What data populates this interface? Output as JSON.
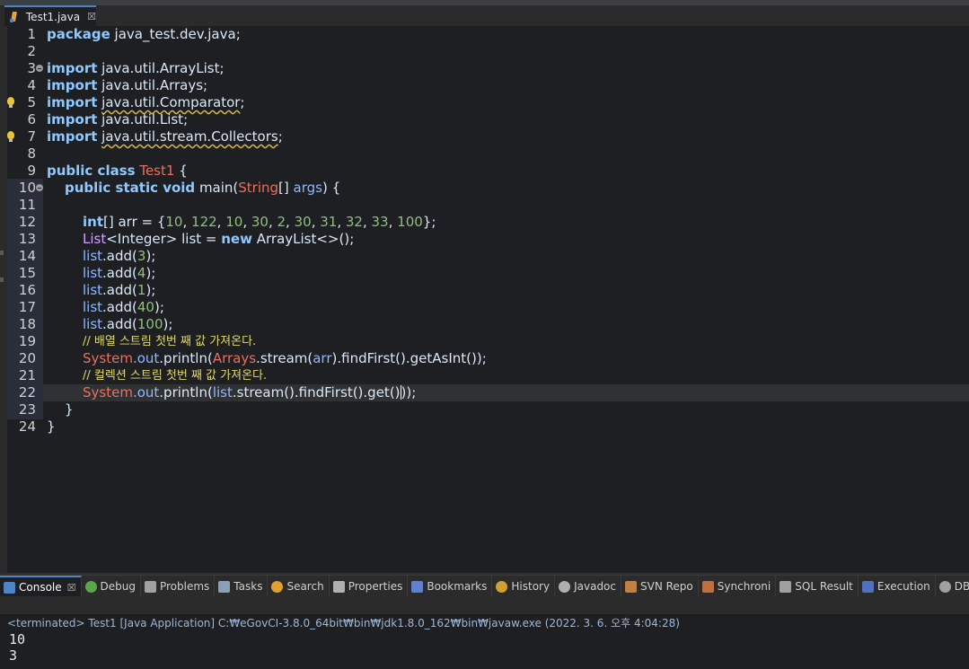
{
  "editor_tab": {
    "title": "Test1.java",
    "close": "☒"
  },
  "code_lines": [
    {
      "n": "1"
    },
    {
      "n": "2"
    },
    {
      "n": "3"
    },
    {
      "n": "4"
    },
    {
      "n": "5"
    },
    {
      "n": "6"
    },
    {
      "n": "7"
    },
    {
      "n": "8"
    },
    {
      "n": "9"
    },
    {
      "n": "10"
    },
    {
      "n": "11"
    },
    {
      "n": "12"
    },
    {
      "n": "13"
    },
    {
      "n": "14"
    },
    {
      "n": "15"
    },
    {
      "n": "16"
    },
    {
      "n": "17"
    },
    {
      "n": "18"
    },
    {
      "n": "19"
    },
    {
      "n": "20"
    },
    {
      "n": "21"
    },
    {
      "n": "22"
    },
    {
      "n": "23"
    },
    {
      "n": "24"
    }
  ],
  "code": {
    "package_kw": "package",
    "package_name": " java_test.dev.java;",
    "import_kw": "import",
    "imp1": " java.util.ArrayList;",
    "imp2": " java.util.Arrays;",
    "imp3_a": " ",
    "imp3_b": "java.util.Comparator",
    "imp3_c": ";",
    "imp4": " java.util.List;",
    "imp5_a": " ",
    "imp5_b": "java.util.stream.Collectors",
    "imp5_c": ";",
    "public_class": "public class",
    "class_name": "Test1",
    "brace_open": " {",
    "main_mods": "public static void",
    "main_name": " main(",
    "string_type": "String",
    "main_args_a": "[] ",
    "main_args": "args",
    "main_args_b": ") {",
    "int_kw": "int",
    "arr_decl": "[] arr = {",
    "arr_vals": [
      "10",
      "122",
      "10",
      "30",
      "2",
      "30",
      "31",
      "32",
      "33",
      "100"
    ],
    "arr_end": "};",
    "list_type": "List",
    "integer_generic": "<Integer>",
    "list_decl": " list = ",
    "new_kw": "new",
    "list_init": " ArrayList<>();",
    "list_var": "list",
    "add_call": ".add(",
    "add_vals": [
      "3",
      "4",
      "1",
      "40",
      "100"
    ],
    "add_end": ");",
    "comment1": "// 배열 스트림 첫번 째 값 가져온다.",
    "system": "System",
    "out_field": ".out",
    "println": ".println(",
    "arrays_cls": "Arrays",
    "stream_call": ".stream(",
    "arr_arg": "arr",
    "line20_end": ").findFirst().getAsInt());",
    "comment2": "// 컬렉션 스트림 첫번 째 값 가져온다.",
    "line22_mid": ".stream().findFirst().get(",
    "line22_end": ");",
    "close_paren": ")",
    "brace_close": "}"
  },
  "panel_tabs": [
    {
      "label": "Console",
      "close": "☒",
      "color": "#4f84c4"
    },
    {
      "label": "Debug",
      "color": "#5aa84a"
    },
    {
      "label": "Problems",
      "color": "#a0a0a0"
    },
    {
      "label": "Tasks",
      "color": "#8aa0b8"
    },
    {
      "label": "Search",
      "color": "#e0a030"
    },
    {
      "label": "Properties",
      "color": "#b0b0b0"
    },
    {
      "label": "Bookmarks",
      "color": "#6080d0"
    },
    {
      "label": "History",
      "color": "#d0a030"
    },
    {
      "label": "Javadoc",
      "color": "#b0b0b0"
    },
    {
      "label": "SVN Repo",
      "color": "#c08040"
    },
    {
      "label": "Synchroni",
      "color": "#c07040"
    },
    {
      "label": "SQL Result",
      "color": "#a0a0a0"
    },
    {
      "label": "Execution",
      "color": "#5070c0"
    },
    {
      "label": "DBIO S",
      "color": "#a0a0a0"
    }
  ],
  "console": {
    "terminated": "<terminated> Test1 [Java Application] C:₩eGovCI-3.8.0_64bit₩bin₩jdk1.8.0_162₩bin₩javaw.exe (2022. 3. 6. 오후 4:04:28)",
    "output": [
      "10",
      "3"
    ]
  }
}
